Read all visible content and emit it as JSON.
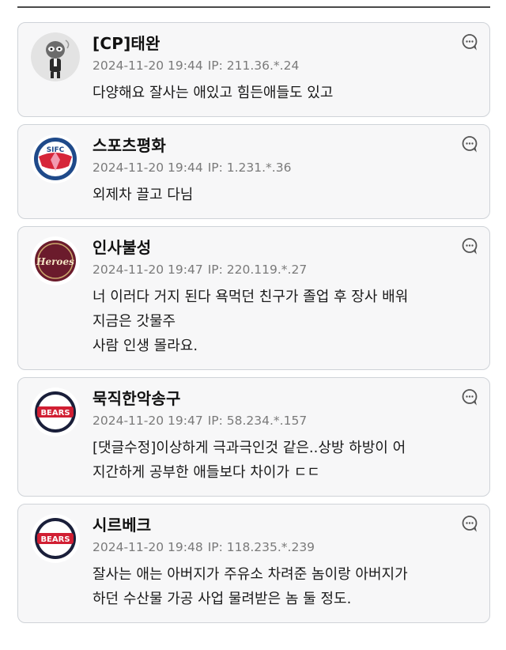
{
  "comments": [
    {
      "nickname": "[CP]태완",
      "date": "2024-11-20 19:44",
      "ip": "IP: 211.36.*.24",
      "text": "다양해요 잘사는 애있고 힘든애들도 있고",
      "avatar_icon": "cartoon-character-icon"
    },
    {
      "nickname": "스포츠평화",
      "date": "2024-11-20 19:44",
      "ip": "IP: 1.231.*.36",
      "text": "외제차 끌고 다님",
      "avatar_icon": "sifc-emblem-icon",
      "avatar_text": "SIFC"
    },
    {
      "nickname": "인사불성",
      "date": "2024-11-20 19:47",
      "ip": "IP: 220.119.*.27",
      "text": "너 이러다 거지 된다 욕먹던 친구가 졸업 후 장사 배워\n지금은 갓물주\n사람 인생 몰라요.",
      "avatar_icon": "heroes-logo-icon",
      "avatar_text": "Heroes"
    },
    {
      "nickname": "묵직한악송구",
      "date": "2024-11-20 19:47",
      "ip": "IP: 58.234.*.157",
      "text": "[댓글수정]이상하게 극과극인것 같은..상방 하방이 어\n지간하게 공부한 애들보다 차이가 ㄷㄷ",
      "avatar_icon": "bears-logo-icon",
      "avatar_text": "BEARS"
    },
    {
      "nickname": "시르베크",
      "date": "2024-11-20 19:48",
      "ip": "IP: 118.235.*.239",
      "text": "잘사는 애는 아버지가 주유소 차려준 놈이랑 아버지가\n하던 수산물 가공 사업 물려받은 놈 둘 정도.",
      "avatar_icon": "bears-logo-icon",
      "avatar_text": "BEARS"
    }
  ],
  "icons": {
    "reply": "reply-bubble-icon"
  },
  "colors": {
    "card_bg": "#f7f7f8",
    "card_border": "#cfd3d8",
    "meta_text": "#7a7a7a"
  }
}
